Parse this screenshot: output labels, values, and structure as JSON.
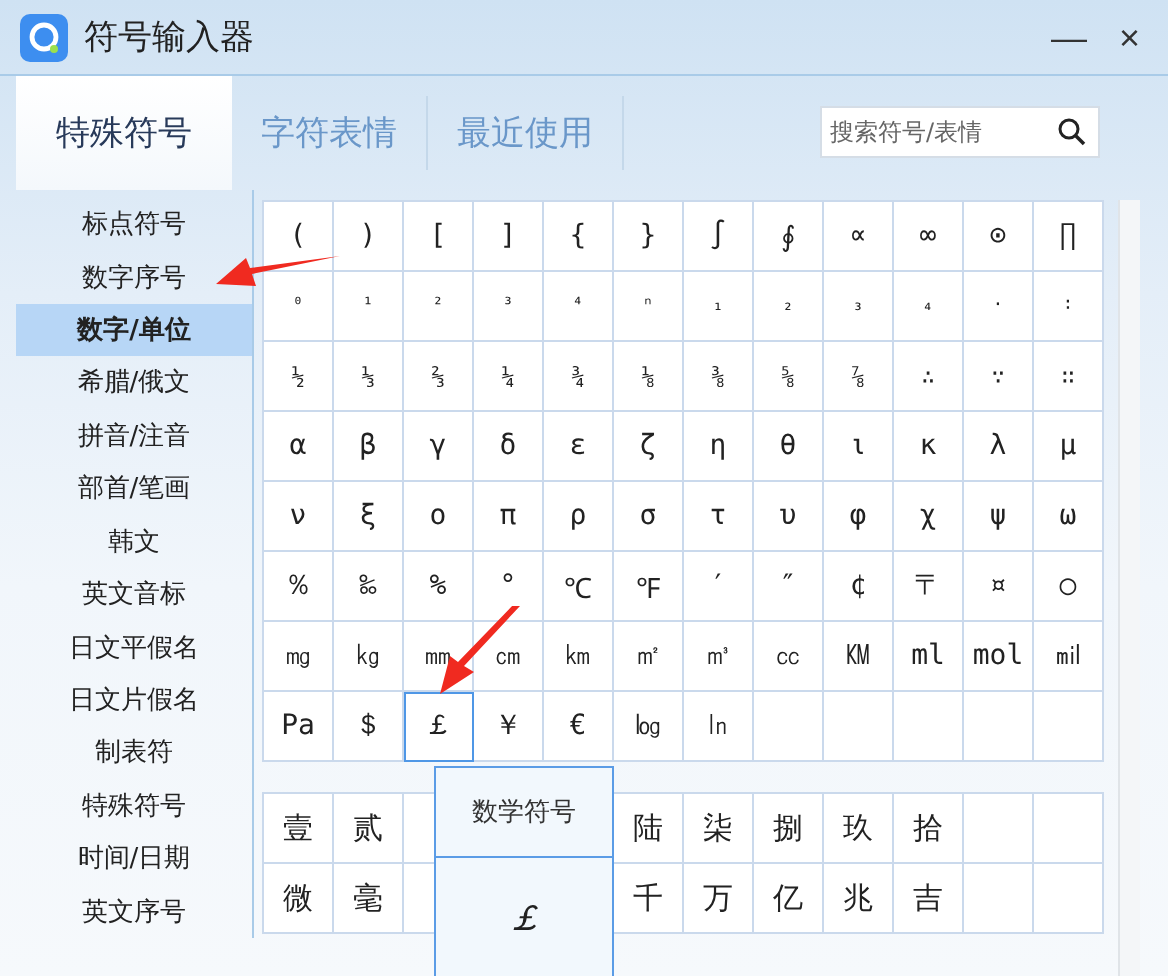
{
  "window": {
    "title": "符号输入器",
    "minimize": "—",
    "close": "×"
  },
  "tabs": [
    {
      "label": "特殊符号",
      "selected": true
    },
    {
      "label": "字符表情",
      "selected": false
    },
    {
      "label": "最近使用",
      "selected": false
    }
  ],
  "search": {
    "placeholder": "搜索符号/表情"
  },
  "sidebar": {
    "items": [
      {
        "label": "标点符号",
        "selected": false
      },
      {
        "label": "数字序号",
        "selected": false
      },
      {
        "label": "数字/单位",
        "selected": true
      },
      {
        "label": "希腊/俄文",
        "selected": false
      },
      {
        "label": "拼音/注音",
        "selected": false
      },
      {
        "label": "部首/笔画",
        "selected": false
      },
      {
        "label": "韩文",
        "selected": false
      },
      {
        "label": "英文音标",
        "selected": false
      },
      {
        "label": "日文平假名",
        "selected": false
      },
      {
        "label": "日文片假名",
        "selected": false
      },
      {
        "label": "制表符",
        "selected": false
      },
      {
        "label": "特殊符号",
        "selected": false
      },
      {
        "label": "时间/日期",
        "selected": false
      },
      {
        "label": "英文序号",
        "selected": false
      }
    ]
  },
  "symbol_grid": {
    "rows": [
      [
        {
          "symbol": "(",
          "selected": false
        },
        {
          "symbol": ")",
          "selected": false
        },
        {
          "symbol": "[",
          "selected": false
        },
        {
          "symbol": "]",
          "selected": false
        },
        {
          "symbol": "{",
          "selected": false
        },
        {
          "symbol": "}",
          "selected": false
        },
        {
          "symbol": "∫",
          "selected": false
        },
        {
          "symbol": "∮",
          "selected": false
        },
        {
          "symbol": "∝",
          "selected": false
        },
        {
          "symbol": "∞",
          "selected": false
        },
        {
          "symbol": "⊙",
          "selected": false
        },
        {
          "symbol": "∏",
          "selected": false
        }
      ],
      [
        {
          "symbol": "⁰",
          "selected": false
        },
        {
          "symbol": "¹",
          "selected": false
        },
        {
          "symbol": "²",
          "selected": false
        },
        {
          "symbol": "³",
          "selected": false
        },
        {
          "symbol": "⁴",
          "selected": false
        },
        {
          "symbol": "ⁿ",
          "selected": false
        },
        {
          "symbol": "₁",
          "selected": false
        },
        {
          "symbol": "₂",
          "selected": false
        },
        {
          "symbol": "₃",
          "selected": false
        },
        {
          "symbol": "₄",
          "selected": false
        },
        {
          "symbol": "·",
          "selected": false
        },
        {
          "symbol": "∶",
          "selected": false
        }
      ],
      [
        {
          "symbol": "½",
          "selected": false
        },
        {
          "symbol": "⅓",
          "selected": false
        },
        {
          "symbol": "⅔",
          "selected": false
        },
        {
          "symbol": "¼",
          "selected": false
        },
        {
          "symbol": "¾",
          "selected": false
        },
        {
          "symbol": "⅛",
          "selected": false
        },
        {
          "symbol": "⅜",
          "selected": false
        },
        {
          "symbol": "⅝",
          "selected": false
        },
        {
          "symbol": "⅞",
          "selected": false
        },
        {
          "symbol": "∴",
          "selected": false
        },
        {
          "symbol": "∵",
          "selected": false
        },
        {
          "symbol": "∷",
          "selected": false
        }
      ],
      [
        {
          "symbol": "α",
          "selected": false
        },
        {
          "symbol": "β",
          "selected": false
        },
        {
          "symbol": "γ",
          "selected": false
        },
        {
          "symbol": "δ",
          "selected": false
        },
        {
          "symbol": "ε",
          "selected": false
        },
        {
          "symbol": "ζ",
          "selected": false
        },
        {
          "symbol": "η",
          "selected": false
        },
        {
          "symbol": "θ",
          "selected": false
        },
        {
          "symbol": "ι",
          "selected": false
        },
        {
          "symbol": "κ",
          "selected": false
        },
        {
          "symbol": "λ",
          "selected": false
        },
        {
          "symbol": "μ",
          "selected": false
        }
      ],
      [
        {
          "symbol": "ν",
          "selected": false
        },
        {
          "symbol": "ξ",
          "selected": false
        },
        {
          "symbol": "ο",
          "selected": false
        },
        {
          "symbol": "π",
          "selected": false
        },
        {
          "symbol": "ρ",
          "selected": false
        },
        {
          "symbol": "σ",
          "selected": false
        },
        {
          "symbol": "τ",
          "selected": false
        },
        {
          "symbol": "υ",
          "selected": false
        },
        {
          "symbol": "φ",
          "selected": false
        },
        {
          "symbol": "χ",
          "selected": false
        },
        {
          "symbol": "ψ",
          "selected": false
        },
        {
          "symbol": "ω",
          "selected": false
        }
      ],
      [
        {
          "symbol": "％",
          "selected": false
        },
        {
          "symbol": "‰",
          "selected": false
        },
        {
          "symbol": "%",
          "selected": false
        },
        {
          "symbol": "°",
          "selected": false
        },
        {
          "symbol": "℃",
          "selected": false
        },
        {
          "symbol": "℉",
          "selected": false
        },
        {
          "symbol": "′",
          "selected": false
        },
        {
          "symbol": "″",
          "selected": false
        },
        {
          "symbol": "¢",
          "selected": false
        },
        {
          "symbol": "〒",
          "selected": false
        },
        {
          "symbol": "¤",
          "selected": false
        },
        {
          "symbol": "○",
          "selected": false
        }
      ],
      [
        {
          "symbol": "㎎",
          "selected": false
        },
        {
          "symbol": "㎏",
          "selected": false
        },
        {
          "symbol": "㎜",
          "selected": false
        },
        {
          "symbol": "㎝",
          "selected": false
        },
        {
          "symbol": "㎞",
          "selected": false
        },
        {
          "symbol": "㎡",
          "selected": false
        },
        {
          "symbol": "㎥",
          "selected": false
        },
        {
          "symbol": "㏄",
          "selected": false
        },
        {
          "symbol": "㏎",
          "selected": false
        },
        {
          "symbol": "ml",
          "selected": false
        },
        {
          "symbol": "mol",
          "selected": false
        },
        {
          "symbol": "㏕",
          "selected": false
        }
      ],
      [
        {
          "symbol": "Pa",
          "selected": false
        },
        {
          "symbol": "＄",
          "selected": false
        },
        {
          "symbol": "￡",
          "selected": true
        },
        {
          "symbol": "￥",
          "selected": false
        },
        {
          "symbol": "€",
          "selected": false
        },
        {
          "symbol": "㏒",
          "selected": false
        },
        {
          "symbol": "㏑",
          "selected": false
        },
        {
          "selected": false
        },
        {
          "selected": false
        },
        {
          "selected": false
        },
        {
          "selected": false
        },
        {
          "selected": false
        }
      ]
    ]
  },
  "numeral_grid": {
    "rows": [
      [
        "壹",
        "贰",
        null,
        null,
        null,
        "陆",
        "柒",
        "捌",
        "玖",
        "拾",
        null,
        null
      ],
      [
        "微",
        "毫",
        null,
        null,
        null,
        "千",
        "万",
        "亿",
        "兆",
        "吉",
        null,
        null
      ]
    ]
  },
  "tooltip": {
    "title": "数学符号",
    "symbol": "￡"
  }
}
